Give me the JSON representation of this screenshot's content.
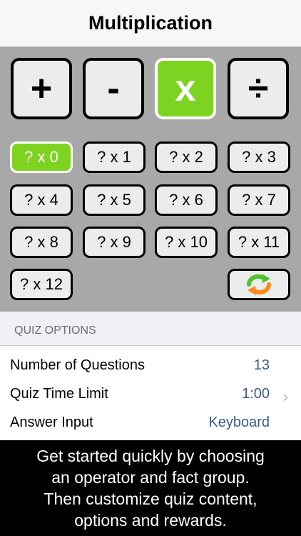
{
  "nav": {
    "title": "Multiplication"
  },
  "operators": [
    {
      "label": "+",
      "selected": false
    },
    {
      "label": "-",
      "selected": false
    },
    {
      "label": "x",
      "selected": true
    },
    {
      "label": "÷",
      "selected": false
    }
  ],
  "facts": [
    "? x 0",
    "? x 1",
    "? x 2",
    "? x 3",
    "? x 4",
    "? x 5",
    "? x 6",
    "? x 7",
    "? x 8",
    "? x 9",
    "? x 10",
    "? x 11",
    "? x 12"
  ],
  "selected_fact": "? x 0",
  "refresh_icon": "refresh-arrows-icon",
  "quiz_options": {
    "header": "QUIZ OPTIONS",
    "rows": [
      {
        "label": "Number of Questions",
        "value": "13"
      },
      {
        "label": "Quiz Time Limit",
        "value": "1:00",
        "chevron": "›"
      },
      {
        "label": "Answer Input",
        "value": "Keyboard"
      }
    ]
  },
  "caption": {
    "lines": [
      "Get started quickly by choosing",
      "an operator and fact group.",
      "Then customize quiz content,",
      "options and rewards."
    ]
  },
  "colors": {
    "accent_green": "#7ed321",
    "panel_gray": "#a8a8a8",
    "value_blue": "#3a5a8c"
  }
}
